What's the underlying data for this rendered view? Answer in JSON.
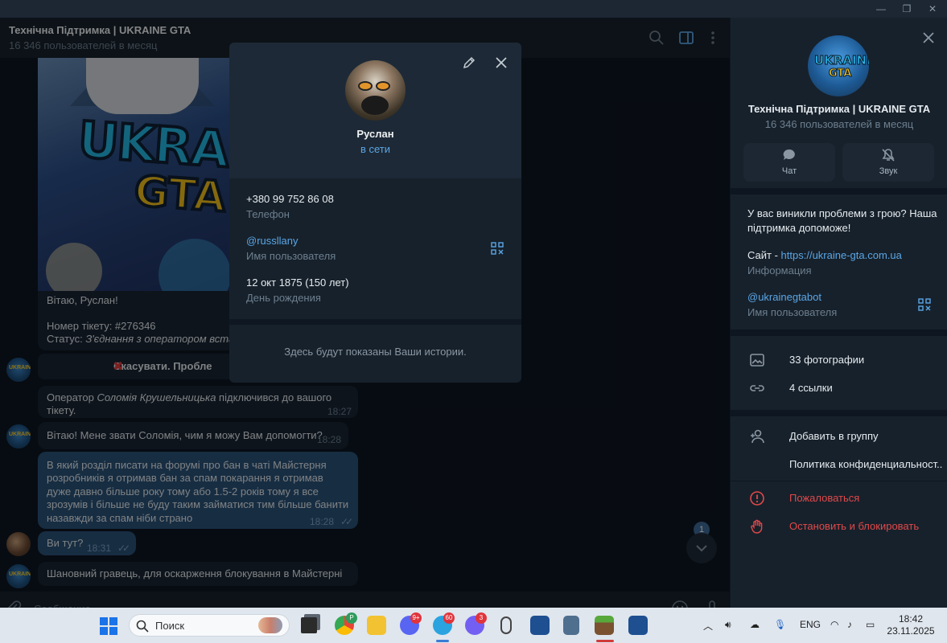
{
  "window": {
    "minimize_glyph": "—",
    "restore_glyph": "❐",
    "close_glyph": "✕"
  },
  "chat": {
    "title": "Технічна Підтримка | UKRAINE GTA",
    "subtitle": "16 346 пользователей в месяц",
    "image_text": {
      "line1": "UKRAINE",
      "line2": "GTA"
    },
    "ticket_greeting": "Вітаю, Руслан!",
    "ticket_number": "Номер тікету: #276346",
    "ticket_status_label": "Статус: ",
    "ticket_status_value": "З'єднання з оператором встано",
    "cancel_button": "Скасувати. Пробле",
    "messages": [
      {
        "text_pre": "Оператор ",
        "text_em": "Соломія Крушельницька",
        "text_post": " підключився до вашого тікету.",
        "time": "18:27"
      },
      {
        "text": "Вітаю! Мене звати Соломія, чим я можу Вам допомогти?",
        "time": "18:28"
      },
      {
        "text": "В який розділ писати на форумі про бан в чаті Майстерня розробників я отримав бан за спам покарання я отримав дуже давно більше року тому або 1.5-2 років тому я все зрозумів і більше не буду таким займатися тим більше банити назавжди за спам ніби страно",
        "time": "18:28"
      },
      {
        "text": "Ви тут?",
        "time": "18:31"
      },
      {
        "text": "Шановний гравець, для оскарження блокування в Майстерні"
      }
    ],
    "unread_count": "1",
    "composer_placeholder": "Сообщение..."
  },
  "profile_modal": {
    "name": "Руслан",
    "status": "в сети",
    "phone": "+380 99 752 86 08",
    "phone_label": "Телефон",
    "username": "@russllany",
    "username_label": "Имя пользователя",
    "birthday": "12 окт 1875 (150 лет)",
    "birthday_label": "День рождения",
    "stories_text": "Здесь будут показаны Ваши истории."
  },
  "right_panel": {
    "title": "Технічна Підтримка | UKRAINE GTA",
    "subtitle": "16 346 пользователей в месяц",
    "avatar_text": {
      "line1": "UKRAINE",
      "line2": "GTA"
    },
    "actions": [
      {
        "label": "Чат",
        "icon": "chat-icon"
      },
      {
        "label": "Звук",
        "icon": "mute-icon"
      }
    ],
    "description": "У вас виникли проблеми з грою? Наша підтримка допоможе!",
    "site_prefix": "Сайт - ",
    "site_link": "https://ukraine-gta.com.ua",
    "info_label": "Информация",
    "username": "@ukrainegtabot",
    "username_label": "Имя пользователя",
    "media": [
      {
        "label": "33 фотографии",
        "icon": "photo-icon"
      },
      {
        "label": "4 ссылки",
        "icon": "link-icon"
      }
    ],
    "add_to_group": "Добавить в группу",
    "privacy": "Политика конфиденциальност...",
    "report": "Пожаловаться",
    "block": "Остановить и блокировать"
  },
  "taskbar": {
    "search_label": "Поиск",
    "badges": {
      "chrome": "P",
      "discord": "9+",
      "telegram": "60",
      "viber": "3"
    },
    "language": "ENG",
    "time": "18:42",
    "date": "23.11.2025"
  },
  "colors": {
    "accent": "#5aa6e6",
    "danger": "#e0494a",
    "outgoing_bubble": "#2b5278",
    "incoming_bubble": "#182533"
  }
}
